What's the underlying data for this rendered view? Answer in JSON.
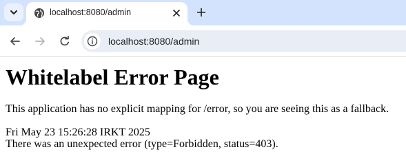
{
  "tabs": [
    {
      "title": "localhost:8080/admin",
      "favicon": "globe-icon",
      "active": true
    }
  ],
  "toolbar": {
    "url": "localhost:8080/admin",
    "icons": [
      "back-arrow-icon",
      "forward-arrow-icon",
      "reload-icon",
      "site-info-icon"
    ]
  },
  "page": {
    "heading": "Whitelabel Error Page",
    "message": "This application has no explicit mapping for /error, so you are seeing this as a fallback.",
    "timestamp": "Fri May 23 15:26:28 IRKT 2025",
    "detail": "There was an unexpected error (type=Forbidden, status=403)."
  },
  "colors": {
    "tabstrip": "#d3e3fd",
    "omnibox": "#e9eef6",
    "page_background": "#ffffff"
  }
}
